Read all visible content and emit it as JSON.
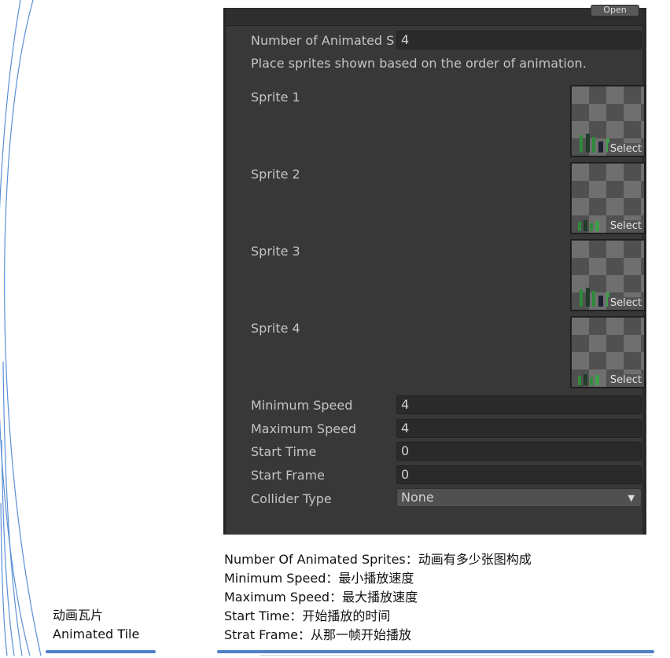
{
  "inspector": {
    "open_button": "Open",
    "number_of_sprites": {
      "label": "Number of Animated S",
      "value": "4"
    },
    "help_text": "Place sprites shown based on the order of animation.",
    "sprites": [
      {
        "label": "Sprite 1",
        "select": "Select",
        "icon": "pixel-tree-sprite"
      },
      {
        "label": "Sprite 2",
        "select": "Select",
        "icon": "pixel-tree-sprite"
      },
      {
        "label": "Sprite 3",
        "select": "Select",
        "icon": "pixel-tree-sprite"
      },
      {
        "label": "Sprite 4",
        "select": "Select",
        "icon": "pixel-tree-sprite"
      }
    ],
    "minimum_speed": {
      "label": "Minimum Speed",
      "value": "4"
    },
    "maximum_speed": {
      "label": "Maximum Speed",
      "value": "4"
    },
    "start_time": {
      "label": "Start Time",
      "value": "0"
    },
    "start_frame": {
      "label": "Start Frame",
      "value": "0"
    },
    "collider_type": {
      "label": "Collider Type",
      "value": "None",
      "icon": "dropdown-arrow-icon"
    }
  },
  "description": {
    "lines": [
      "Number Of Animated Sprites：动画有多少张图构成",
      "Minimum Speed：最小播放速度",
      "Maximum Speed：最大播放速度",
      "Start Time：开始播放的时间",
      "Strat Frame：从那一帧开始播放"
    ]
  },
  "caption": {
    "cn": "动画瓦片",
    "en": "Animated Tile"
  },
  "colors": {
    "panel_bg": "#383838",
    "field_bg": "#2a2a2a",
    "label_text": "#c4c4c4",
    "accent_rule": "#4f7fc7"
  }
}
